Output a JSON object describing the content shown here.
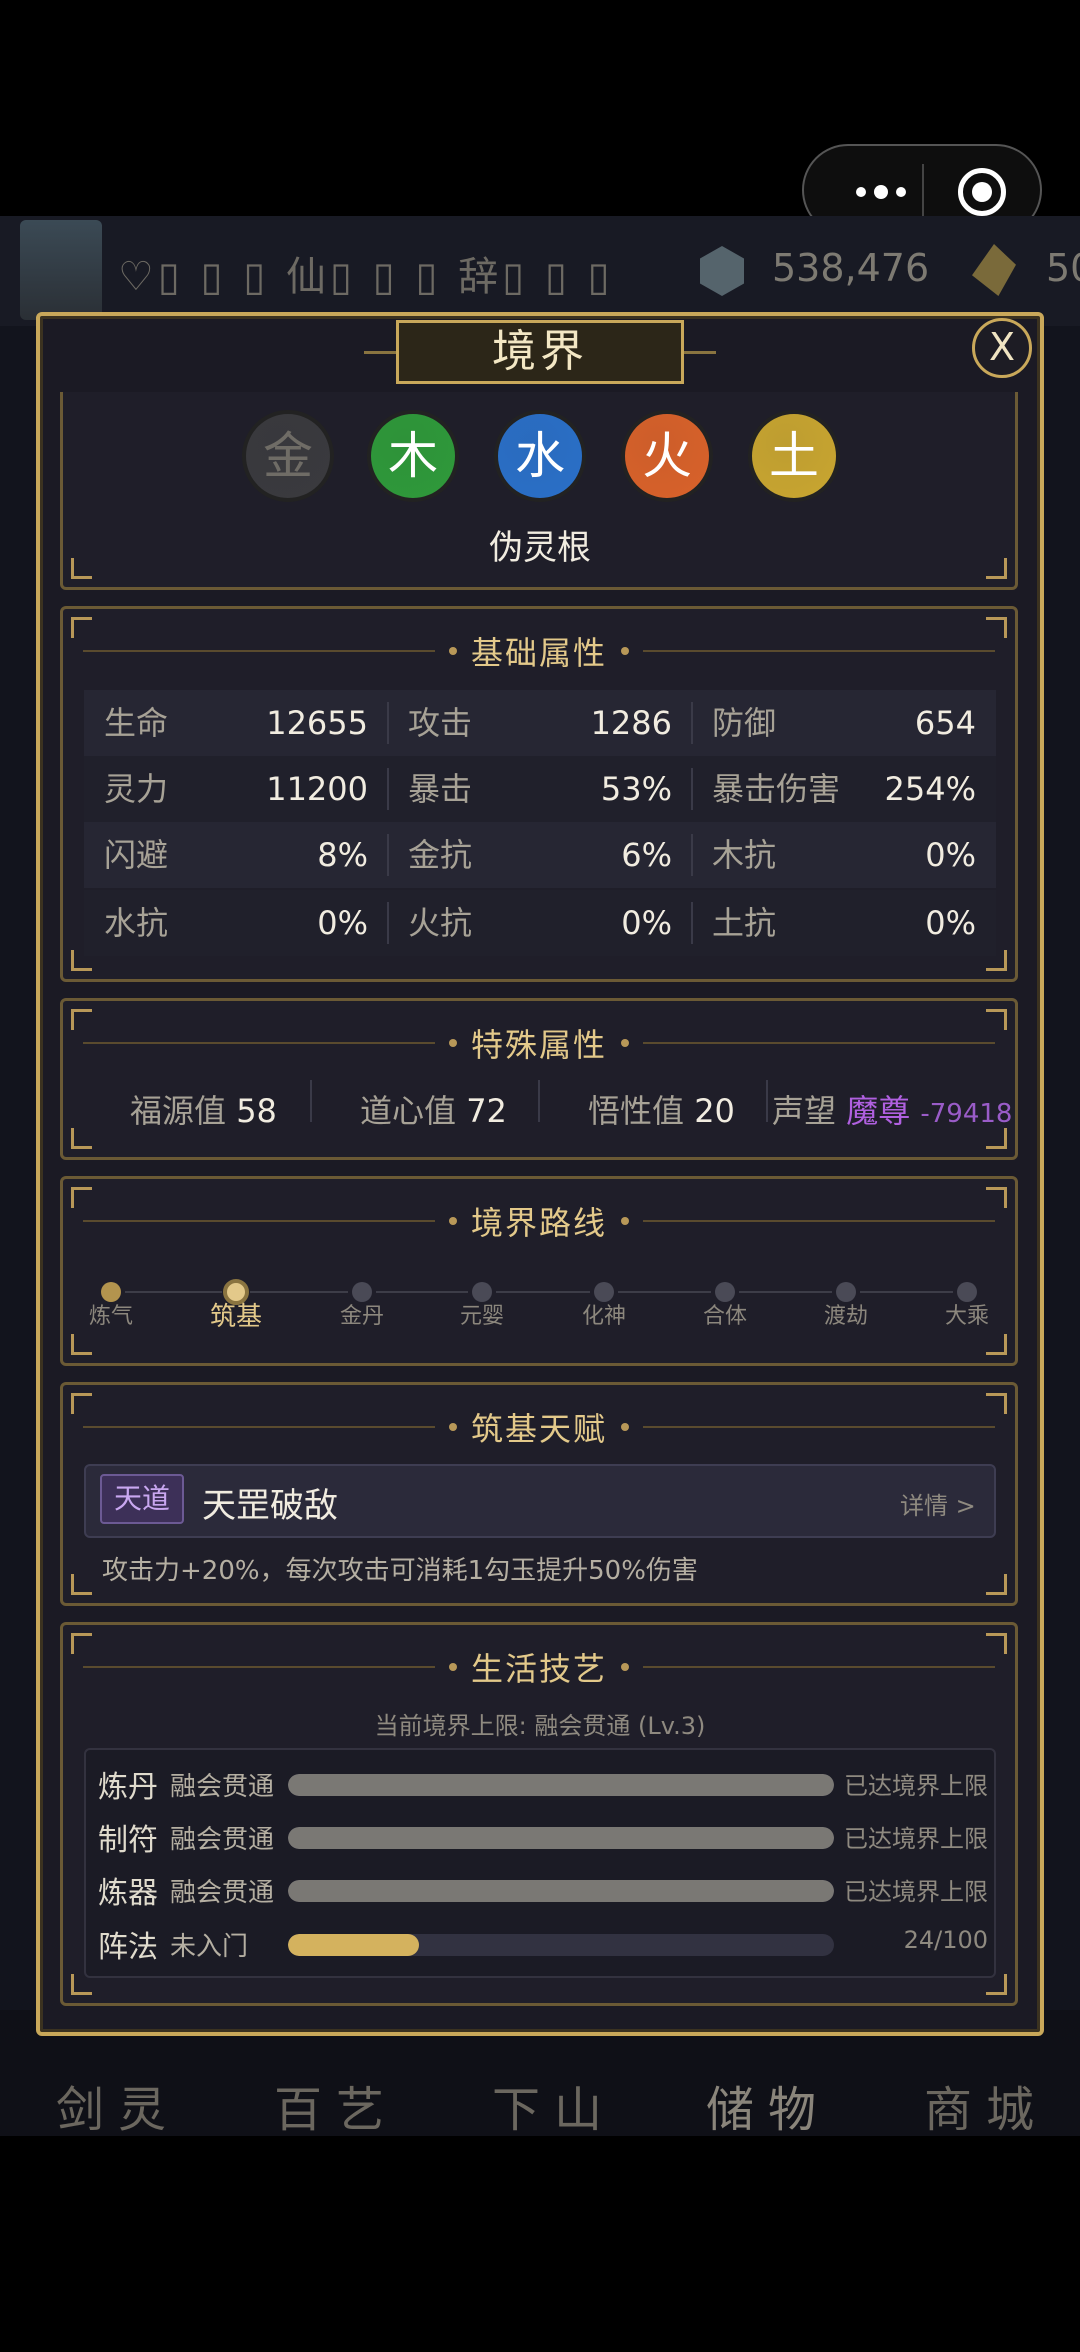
{
  "header": {
    "labels": "♡▯ ▯ ▯ 仙▯ ▯ ▯ 辞▯ ▯ ▯",
    "currency": "538,476",
    "currency2": "50"
  },
  "panel": {
    "title": "境界",
    "close_label": "X"
  },
  "spirit_root": {
    "elements": [
      {
        "char": "金",
        "color": "#3a3a3e",
        "text_color": "#6f6c66"
      },
      {
        "char": "木",
        "color": "#2f9a3a",
        "text_color": "#ffffff"
      },
      {
        "char": "水",
        "color": "#2a70c8",
        "text_color": "#ffffff"
      },
      {
        "char": "火",
        "color": "#d9622a",
        "text_color": "#ffffff"
      },
      {
        "char": "土",
        "color": "#c9a630",
        "text_color": "#ffffff"
      }
    ],
    "name": "伪灵根"
  },
  "basic": {
    "title": "基础属性",
    "rows": [
      [
        {
          "label": "生命",
          "value": "12655"
        },
        {
          "label": "攻击",
          "value": "1286"
        },
        {
          "label": "防御",
          "value": "654"
        }
      ],
      [
        {
          "label": "灵力",
          "value": "11200"
        },
        {
          "label": "暴击",
          "value": "53%"
        },
        {
          "label": "暴击伤害",
          "value": "254%"
        }
      ],
      [
        {
          "label": "闪避",
          "value": "8%"
        },
        {
          "label": "金抗",
          "value": "6%"
        },
        {
          "label": "木抗",
          "value": "0%"
        }
      ],
      [
        {
          "label": "水抗",
          "value": "0%"
        },
        {
          "label": "火抗",
          "value": "0%"
        },
        {
          "label": "土抗",
          "value": "0%"
        }
      ]
    ]
  },
  "special": {
    "title": "特殊属性",
    "items": [
      {
        "label": "福源值",
        "value": "58"
      },
      {
        "label": "道心值",
        "value": "72"
      },
      {
        "label": "悟性值",
        "value": "20"
      }
    ],
    "reputation": {
      "label": "声望",
      "title": "魔尊",
      "value": "-79418",
      "title_color": "#b060e0"
    }
  },
  "path": {
    "title": "境界路线",
    "stages": [
      "炼气",
      "筑基",
      "金丹",
      "元婴",
      "化神",
      "合体",
      "渡劫",
      "大乘"
    ],
    "current_index": 1
  },
  "talent": {
    "title": "筑基天赋",
    "tag": "天道",
    "name": "天罡破敌",
    "detail": "详情 >",
    "desc": "攻击力+20%，每次攻击可消耗1勾玉提升50%伤害"
  },
  "life": {
    "title": "生活技艺",
    "limit": "当前境界上限: 融会贯通 (Lv.3)",
    "skills": [
      {
        "name": "炼丹",
        "level": "融会贯通",
        "progress": 1.0,
        "status": "已达境界上限",
        "fill": "#7a7874"
      },
      {
        "name": "制符",
        "level": "融会贯通",
        "progress": 1.0,
        "status": "已达境界上限",
        "fill": "#7a7874"
      },
      {
        "name": "炼器",
        "level": "融会贯通",
        "progress": 1.0,
        "status": "已达境界上限",
        "fill": "#7a7874"
      },
      {
        "name": "阵法",
        "level": "未入门",
        "progress": 0.24,
        "status": "24/100",
        "fill": "#d4b25e"
      }
    ]
  },
  "bottom_nav": [
    "剑灵",
    "百艺",
    "下山",
    "储物",
    "商城"
  ]
}
